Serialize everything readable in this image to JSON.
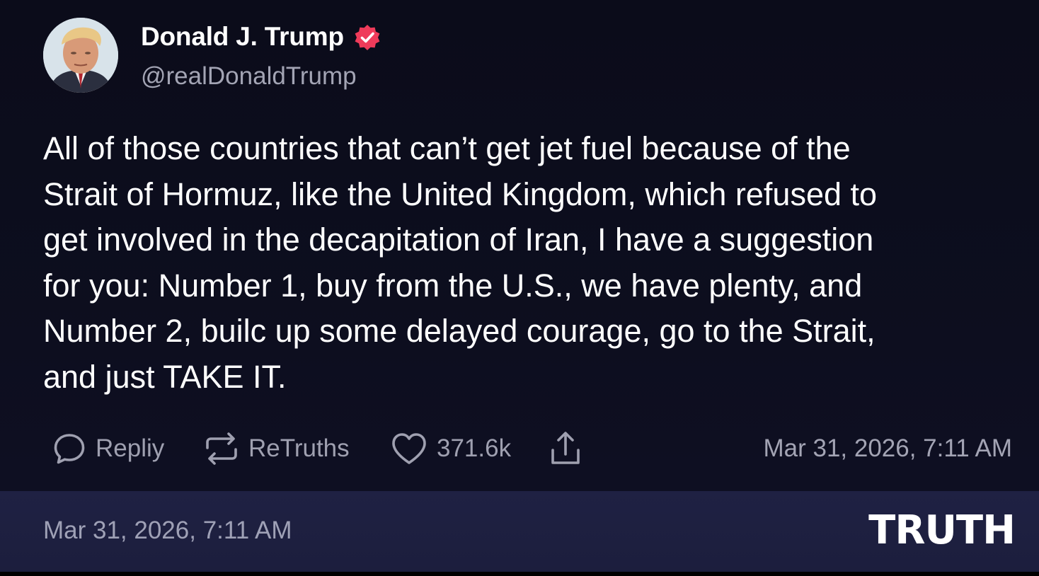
{
  "author": {
    "display_name": "Donald J. Trump",
    "handle": "@realDonaldTrump",
    "verified": true,
    "avatar_icon": "profile-photo"
  },
  "post": {
    "lines": [
      "All of those countries that can’t get jet fuel because of the",
      "Strait of Hormuz, like the United Kingdom, which refused to",
      "get involved in the decapitation of Iran, I have a suggestion",
      "for you: Number 1, buy from the U.S., we have plenty, and",
      "Number 2, builc up some delayed courage, go to the Strait,",
      "and just TAKE IT."
    ],
    "timestamp": "Mar 31, 2026, 7:11 AM"
  },
  "actions": {
    "reply_label": "Repliy",
    "retruth_label": "ReTruths",
    "like_count": "371.6k",
    "icons": [
      "speech-bubble-icon",
      "retruth-arrows-icon",
      "heart-icon",
      "share-icon"
    ]
  },
  "footer": {
    "timestamp": "Mar 31, 2026, 7:11 AM",
    "brand": "TRUTH"
  },
  "colors": {
    "background": "#0c0d1b",
    "footer_background": "#1f2143",
    "verified_badge": "#ef3b5a",
    "muted_text": "#a3a4b4",
    "text": "#ffffff"
  }
}
